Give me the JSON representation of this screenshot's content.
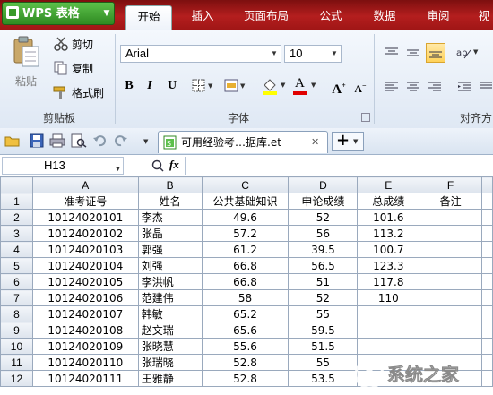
{
  "app": {
    "title": "WPS 表格"
  },
  "ribbon_tabs": [
    "开始",
    "插入",
    "页面布局",
    "公式",
    "数据",
    "审阅",
    "视"
  ],
  "active_tab": "开始",
  "clipboard": {
    "paste": "粘贴",
    "cut": "剪切",
    "copy": "复制",
    "format_painter": "格式刷",
    "group": "剪贴板"
  },
  "font": {
    "name": "Arial",
    "size": "10",
    "group": "字体",
    "bold": "B",
    "italic": "I",
    "underline": "U",
    "grow": "A",
    "shrink": "A",
    "color_letter": "A"
  },
  "align": {
    "group": "对齐方"
  },
  "document": {
    "tab_title": "可用经验考…据库.et",
    "add_label": "+"
  },
  "formula_bar": {
    "cell_ref": "H13",
    "fx": "fx"
  },
  "colors": {
    "ribbon_red": "#b41e1e",
    "wps_green": "#2f8a22",
    "font_color": "#e00000",
    "highlight": "#ffff00"
  },
  "columns": [
    "A",
    "B",
    "C",
    "D",
    "E",
    "F"
  ],
  "rows": [
    {
      "n": "1",
      "cells": [
        "准考证号",
        "姓名",
        "公共基础知识",
        "申论成绩",
        "总成绩",
        "备注"
      ]
    },
    {
      "n": "2",
      "cells": [
        "10124020101",
        "李杰",
        "49.6",
        "52",
        "101.6",
        ""
      ]
    },
    {
      "n": "3",
      "cells": [
        "10124020102",
        "张晶",
        "57.2",
        "56",
        "113.2",
        ""
      ]
    },
    {
      "n": "4",
      "cells": [
        "10124020103",
        "郭强",
        "61.2",
        "39.5",
        "100.7",
        ""
      ]
    },
    {
      "n": "5",
      "cells": [
        "10124020104",
        "刘强",
        "66.8",
        "56.5",
        "123.3",
        ""
      ]
    },
    {
      "n": "6",
      "cells": [
        "10124020105",
        "李洪帆",
        "66.8",
        "51",
        "117.8",
        ""
      ]
    },
    {
      "n": "7",
      "cells": [
        "10124020106",
        "范建伟",
        "58",
        "52",
        "110",
        ""
      ]
    },
    {
      "n": "8",
      "cells": [
        "10124020107",
        "韩敏",
        "65.2",
        "55",
        "",
        ""
      ]
    },
    {
      "n": "9",
      "cells": [
        "10124020108",
        "赵文瑞",
        "65.6",
        "59.5",
        "",
        ""
      ]
    },
    {
      "n": "10",
      "cells": [
        "10124020109",
        "张晓慧",
        "55.6",
        "51.5",
        "",
        ""
      ]
    },
    {
      "n": "11",
      "cells": [
        "10124020110",
        "张瑞晓",
        "52.8",
        "55",
        "",
        ""
      ]
    },
    {
      "n": "12",
      "cells": [
        "10124020111",
        "王雅静",
        "52.8",
        "53.5",
        "",
        ""
      ]
    }
  ],
  "watermark": {
    "text": "系统之家"
  }
}
